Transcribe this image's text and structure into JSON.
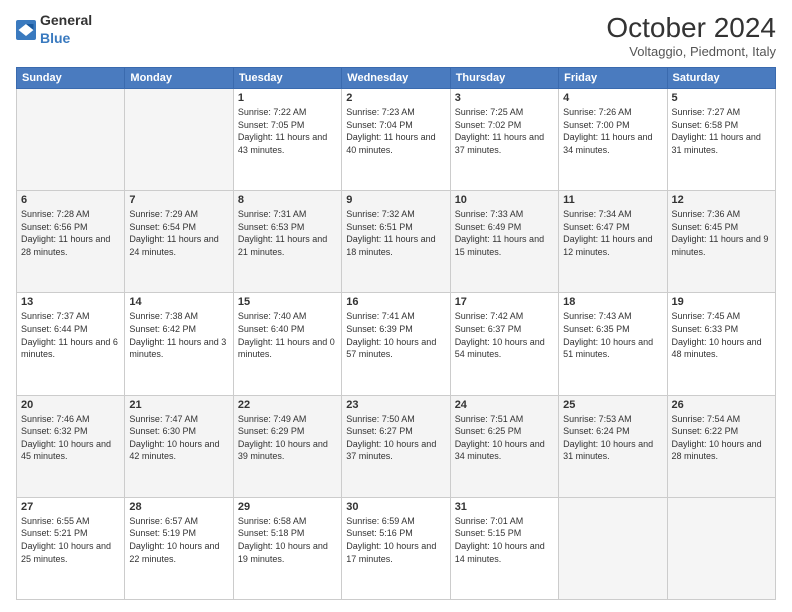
{
  "header": {
    "logo": {
      "general": "General",
      "blue": "Blue"
    },
    "title": "October 2024",
    "location": "Voltaggio, Piedmont, Italy"
  },
  "weekdays": [
    "Sunday",
    "Monday",
    "Tuesday",
    "Wednesday",
    "Thursday",
    "Friday",
    "Saturday"
  ],
  "weeks": [
    [
      null,
      null,
      {
        "day": "1",
        "sunrise": "7:22 AM",
        "sunset": "7:05 PM",
        "daylight": "11 hours and 43 minutes."
      },
      {
        "day": "2",
        "sunrise": "7:23 AM",
        "sunset": "7:04 PM",
        "daylight": "11 hours and 40 minutes."
      },
      {
        "day": "3",
        "sunrise": "7:25 AM",
        "sunset": "7:02 PM",
        "daylight": "11 hours and 37 minutes."
      },
      {
        "day": "4",
        "sunrise": "7:26 AM",
        "sunset": "7:00 PM",
        "daylight": "11 hours and 34 minutes."
      },
      {
        "day": "5",
        "sunrise": "7:27 AM",
        "sunset": "6:58 PM",
        "daylight": "11 hours and 31 minutes."
      }
    ],
    [
      {
        "day": "6",
        "sunrise": "7:28 AM",
        "sunset": "6:56 PM",
        "daylight": "11 hours and 28 minutes."
      },
      {
        "day": "7",
        "sunrise": "7:29 AM",
        "sunset": "6:54 PM",
        "daylight": "11 hours and 24 minutes."
      },
      {
        "day": "8",
        "sunrise": "7:31 AM",
        "sunset": "6:53 PM",
        "daylight": "11 hours and 21 minutes."
      },
      {
        "day": "9",
        "sunrise": "7:32 AM",
        "sunset": "6:51 PM",
        "daylight": "11 hours and 18 minutes."
      },
      {
        "day": "10",
        "sunrise": "7:33 AM",
        "sunset": "6:49 PM",
        "daylight": "11 hours and 15 minutes."
      },
      {
        "day": "11",
        "sunrise": "7:34 AM",
        "sunset": "6:47 PM",
        "daylight": "11 hours and 12 minutes."
      },
      {
        "day": "12",
        "sunrise": "7:36 AM",
        "sunset": "6:45 PM",
        "daylight": "11 hours and 9 minutes."
      }
    ],
    [
      {
        "day": "13",
        "sunrise": "7:37 AM",
        "sunset": "6:44 PM",
        "daylight": "11 hours and 6 minutes."
      },
      {
        "day": "14",
        "sunrise": "7:38 AM",
        "sunset": "6:42 PM",
        "daylight": "11 hours and 3 minutes."
      },
      {
        "day": "15",
        "sunrise": "7:40 AM",
        "sunset": "6:40 PM",
        "daylight": "11 hours and 0 minutes."
      },
      {
        "day": "16",
        "sunrise": "7:41 AM",
        "sunset": "6:39 PM",
        "daylight": "10 hours and 57 minutes."
      },
      {
        "day": "17",
        "sunrise": "7:42 AM",
        "sunset": "6:37 PM",
        "daylight": "10 hours and 54 minutes."
      },
      {
        "day": "18",
        "sunrise": "7:43 AM",
        "sunset": "6:35 PM",
        "daylight": "10 hours and 51 minutes."
      },
      {
        "day": "19",
        "sunrise": "7:45 AM",
        "sunset": "6:33 PM",
        "daylight": "10 hours and 48 minutes."
      }
    ],
    [
      {
        "day": "20",
        "sunrise": "7:46 AM",
        "sunset": "6:32 PM",
        "daylight": "10 hours and 45 minutes."
      },
      {
        "day": "21",
        "sunrise": "7:47 AM",
        "sunset": "6:30 PM",
        "daylight": "10 hours and 42 minutes."
      },
      {
        "day": "22",
        "sunrise": "7:49 AM",
        "sunset": "6:29 PM",
        "daylight": "10 hours and 39 minutes."
      },
      {
        "day": "23",
        "sunrise": "7:50 AM",
        "sunset": "6:27 PM",
        "daylight": "10 hours and 37 minutes."
      },
      {
        "day": "24",
        "sunrise": "7:51 AM",
        "sunset": "6:25 PM",
        "daylight": "10 hours and 34 minutes."
      },
      {
        "day": "25",
        "sunrise": "7:53 AM",
        "sunset": "6:24 PM",
        "daylight": "10 hours and 31 minutes."
      },
      {
        "day": "26",
        "sunrise": "7:54 AM",
        "sunset": "6:22 PM",
        "daylight": "10 hours and 28 minutes."
      }
    ],
    [
      {
        "day": "27",
        "sunrise": "6:55 AM",
        "sunset": "5:21 PM",
        "daylight": "10 hours and 25 minutes."
      },
      {
        "day": "28",
        "sunrise": "6:57 AM",
        "sunset": "5:19 PM",
        "daylight": "10 hours and 22 minutes."
      },
      {
        "day": "29",
        "sunrise": "6:58 AM",
        "sunset": "5:18 PM",
        "daylight": "10 hours and 19 minutes."
      },
      {
        "day": "30",
        "sunrise": "6:59 AM",
        "sunset": "5:16 PM",
        "daylight": "10 hours and 17 minutes."
      },
      {
        "day": "31",
        "sunrise": "7:01 AM",
        "sunset": "5:15 PM",
        "daylight": "10 hours and 14 minutes."
      },
      null,
      null
    ]
  ]
}
